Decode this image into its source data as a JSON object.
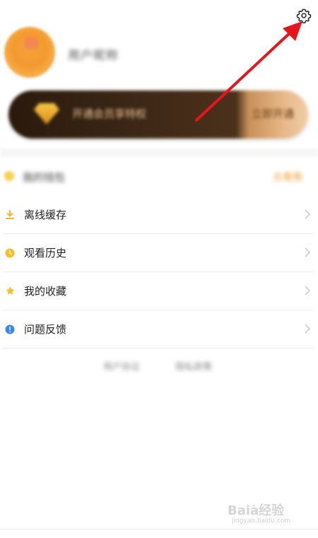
{
  "profile": {
    "username": "用户昵称"
  },
  "vip_banner": {
    "promo_text": "开通会员享特权",
    "button_text": "立即开通"
  },
  "blurred_row": {
    "label": "我的钱包",
    "right": "去看看"
  },
  "menu": {
    "items": [
      {
        "label": "离线缓存",
        "icon": "download-icon",
        "color": "#f5b62a"
      },
      {
        "label": "观看历史",
        "icon": "clock-icon",
        "color": "#f6c021"
      },
      {
        "label": "我的收藏",
        "icon": "star-icon",
        "color": "#f6c021"
      },
      {
        "label": "问题反馈",
        "icon": "info-icon",
        "color": "#3a86f0"
      }
    ]
  },
  "bottom_links": {
    "left": "用户协议",
    "right": "隐私政策"
  },
  "watermark": {
    "brand": "Baià经验",
    "sub": "jingyan.baidu.com"
  },
  "colors": {
    "annotation_arrow": "#e8141c",
    "chevron": "#c9c9c9"
  }
}
